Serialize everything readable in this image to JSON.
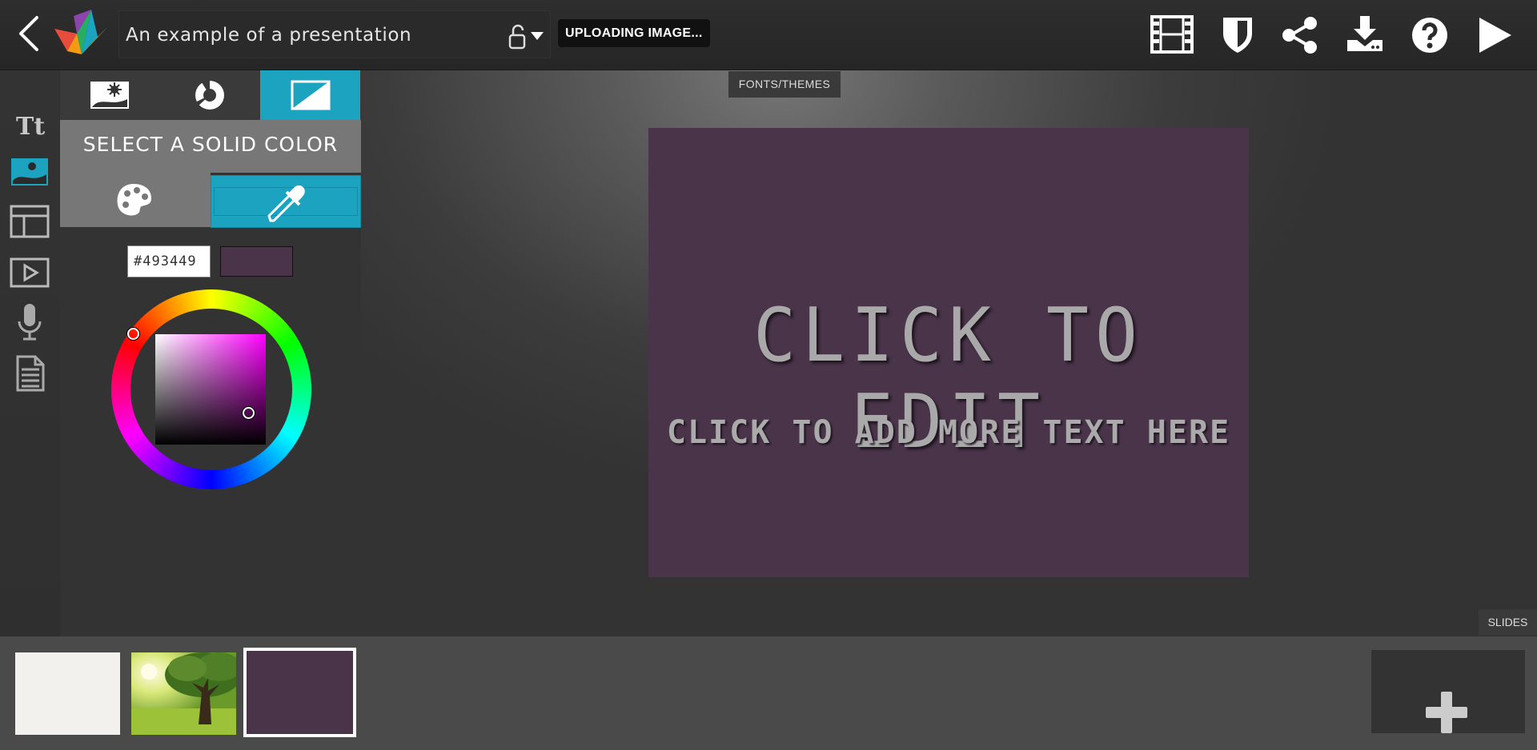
{
  "app": {
    "presentation_title": "An example of a presentation",
    "upload_status": "UPLOADING IMAGE..."
  },
  "toolbar": {
    "icons": [
      "back-icon",
      "lock-icon",
      "film-icon",
      "shield-icon",
      "share-icon",
      "download-icon",
      "help-icon",
      "play-icon"
    ]
  },
  "left_rail": {
    "items": [
      "text-tool-icon",
      "background-icon",
      "layout-icon",
      "video-icon",
      "microphone-icon",
      "notes-icon"
    ],
    "active": "background-icon"
  },
  "panel": {
    "tabs": [
      "image-background-icon",
      "theme-color-icon",
      "solid-color-icon"
    ],
    "active_tab": "solid-color-icon",
    "heading": "SELECT A SOLID COLOR",
    "modes": [
      "palette-icon",
      "eyedropper-icon"
    ],
    "active_mode": "eyedropper-icon",
    "hex_value": "#493449",
    "current_color": "#493449"
  },
  "stage": {
    "fonts_label": "FONTS/THEMES",
    "slide_title": "CLICK TO EDIT",
    "slide_subtitle": "CLICK TO ADD MORE TEXT HERE",
    "slide_background": "#493449",
    "slides_label": "SLIDES"
  },
  "slides": {
    "thumbnails": [
      "blank-white-slide",
      "tree-photo-slide",
      "purple-slide"
    ],
    "selected_index": 2,
    "add_button": "add-slide-icon"
  },
  "colors": {
    "accent": "#1ba3c0",
    "topbar": "#2b2b2b",
    "panel_heading": "#777777"
  }
}
